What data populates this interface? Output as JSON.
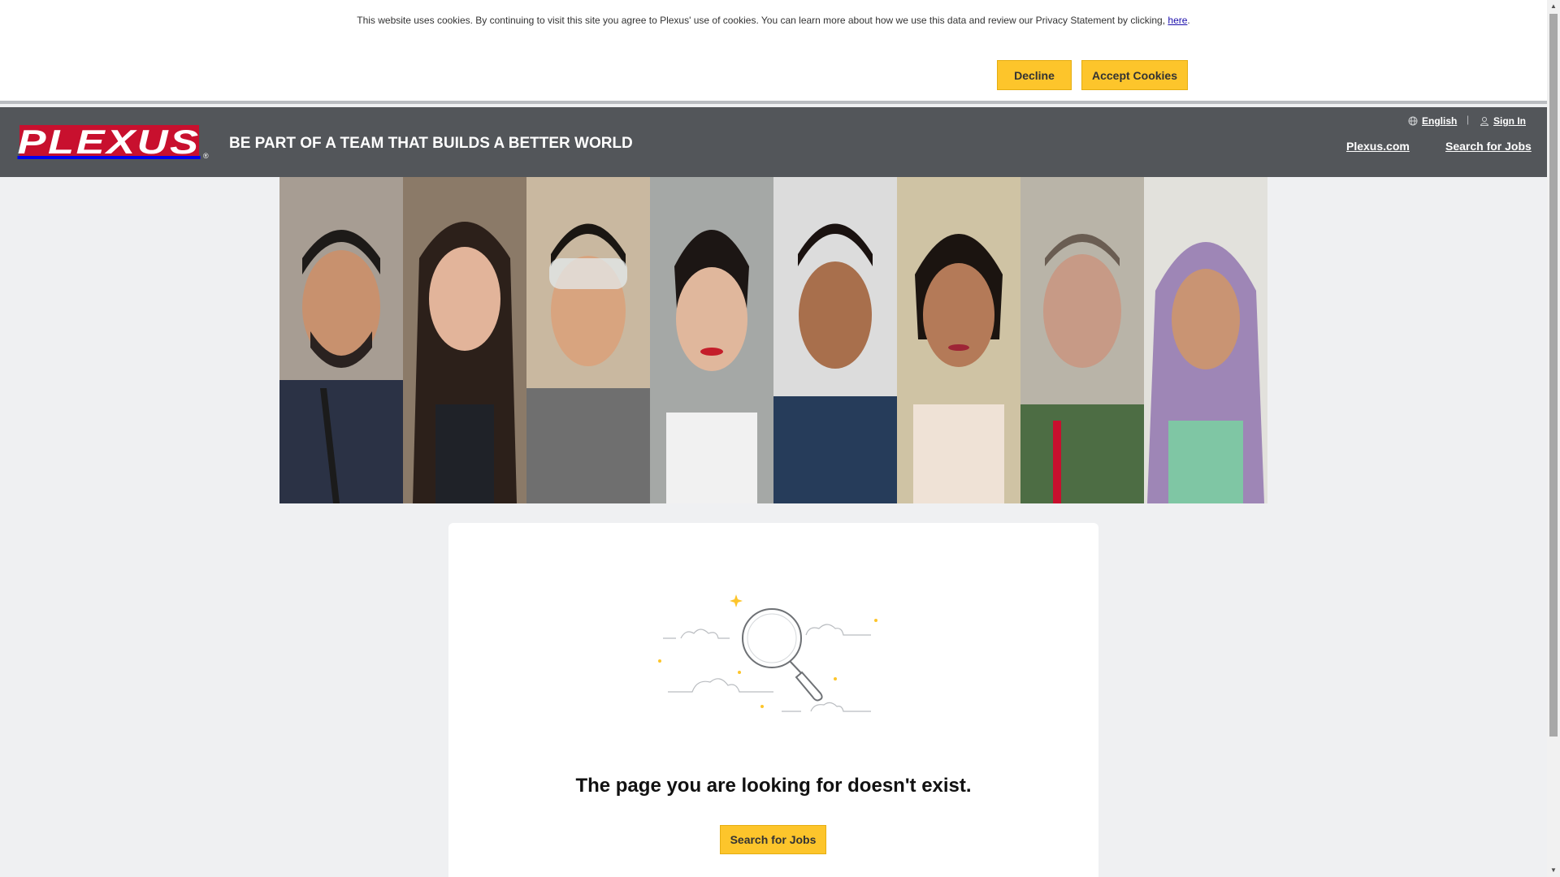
{
  "cookie_banner": {
    "message": "This website uses cookies. By continuing to visit this site you agree to Plexus' use of cookies. You can learn more about how we use this data and review our Privacy Statement by clicking, ",
    "link_text": "here",
    "trailing": ".",
    "decline_label": "Decline",
    "accept_label": "Accept Cookies"
  },
  "header": {
    "logo_text": "PLEXUS",
    "logo_reg": "®",
    "tagline": "BE PART OF A TEAM THAT BUILDS A BETTER WORLD",
    "language": "English",
    "separator": "|",
    "sign_in": "Sign In",
    "nav": {
      "plexus_com": "Plexus.com",
      "search_jobs": "Search for Jobs"
    }
  },
  "hero": {
    "portrait_count": 8
  },
  "error_card": {
    "message": "The page you are looking for doesn't exist.",
    "button_label": "Search for Jobs"
  },
  "scrollbar": {
    "up_arrow": "▲",
    "down_arrow": "▼"
  },
  "colors": {
    "accent": "#fdc52b",
    "header": "#53565a",
    "brand_red": "#c8102e",
    "page_bg": "#eff0f2"
  },
  "icons": {
    "language": "globe-icon",
    "sign_in": "user-icon",
    "illustration": "magnifying-glass-icon"
  }
}
